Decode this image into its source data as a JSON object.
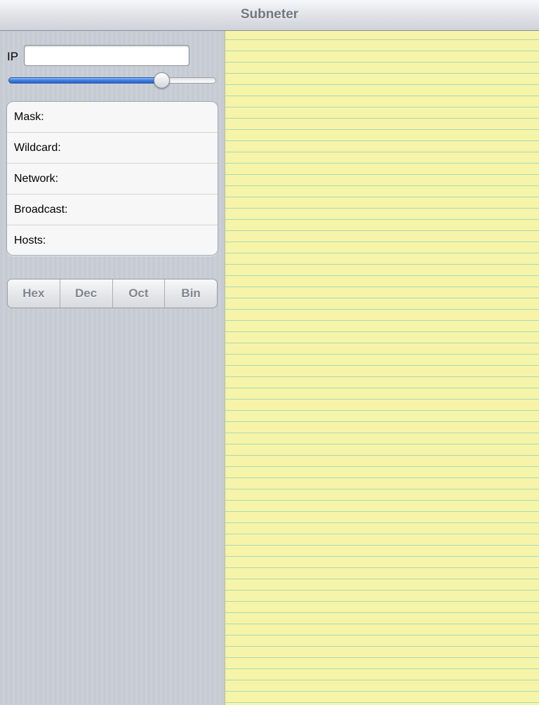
{
  "navbar": {
    "title": "Subneter"
  },
  "sidebar": {
    "ip_label": "IP",
    "ip_value": "",
    "slider_fraction": 0.74,
    "rows": [
      {
        "label": "Mask:",
        "value": ""
      },
      {
        "label": "Wildcard:",
        "value": ""
      },
      {
        "label": "Network:",
        "value": ""
      },
      {
        "label": "Broadcast:",
        "value": ""
      },
      {
        "label": "Hosts:",
        "value": ""
      }
    ],
    "segments": [
      "Hex",
      "Dec",
      "Oct",
      "Bin"
    ]
  },
  "notepad": {
    "text": ""
  },
  "colors": {
    "sidebar_bg": "#c9cfd8",
    "notepad_bg": "#f6f4a8",
    "notepad_lines": "#a9d9b6",
    "slider_blue": "#3f7fe0",
    "title_gray": "#71787f"
  }
}
